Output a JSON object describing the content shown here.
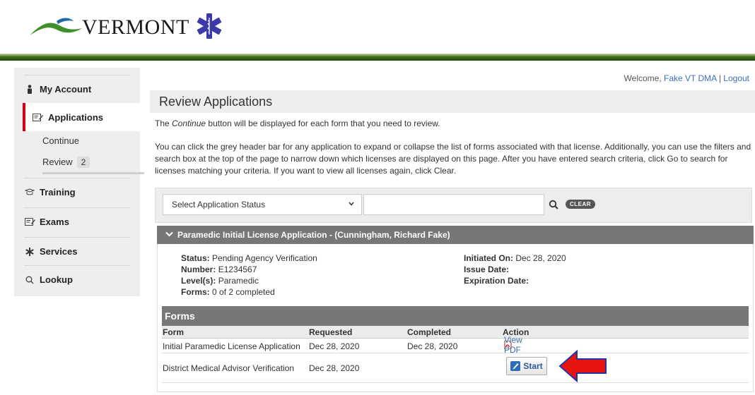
{
  "brand": {
    "name": "VERMONT"
  },
  "header": {
    "welcome_prefix": "Welcome,",
    "user_name": "Fake VT DMA",
    "separator": "|",
    "logout_label": "Logout"
  },
  "sidebar": {
    "my_account": "My Account",
    "applications": "Applications",
    "continue": "Continue",
    "review": "Review",
    "review_count": "2",
    "training": "Training",
    "exams": "Exams",
    "services": "Services",
    "lookup": "Lookup"
  },
  "page": {
    "title": "Review Applications",
    "desc1_before": "The ",
    "desc1_em": "Continue",
    "desc1_after": " button will be displayed for each form that you need to review.",
    "desc2": "You can click the grey header bar for any application to expand or collapse the list of forms associated with that license. Additionally, you can use the filters and search box at the top of the page to narrow down which licenses are displayed on this page. After you have entered search criteria, click Go to search for licenses matching your criteria. If you want to view all licenses again, click Clear."
  },
  "filter": {
    "status_select_value": "Select Application Status",
    "search_value": "",
    "clear_label": "CLEAR"
  },
  "license": {
    "header": "Paramedic Initial License Application - (Cunningham, Richard Fake)",
    "status_label": "Status:",
    "status_value": "Pending Agency Verification",
    "number_label": "Number:",
    "number_value": "E1234567",
    "levels_label": "Level(s):",
    "levels_value": "Paramedic",
    "forms_label": "Forms:",
    "forms_value": "0 of 2 completed",
    "initiated_label": "Initiated On:",
    "initiated_value": "Dec 28, 2020",
    "issue_label": "Issue Date:",
    "issue_value": "",
    "expiration_label": "Expiration Date:",
    "expiration_value": ""
  },
  "forms": {
    "title": "Forms",
    "columns": [
      "Form",
      "Requested",
      "Completed",
      "Action"
    ],
    "rows": [
      {
        "form": "Initial Paramedic License Application",
        "requested": "Dec 28, 2020",
        "completed": "Dec 28, 2020",
        "action": "View PDF"
      },
      {
        "form": "District Medical Advisor Verification",
        "requested": "Dec 28, 2020",
        "completed": "",
        "action": "Start"
      }
    ]
  },
  "colors": {
    "accent_red": "#d0021b",
    "header_grey": "#777777",
    "brand_green": "#1d4a0b",
    "link_blue": "#3a6fb5"
  }
}
